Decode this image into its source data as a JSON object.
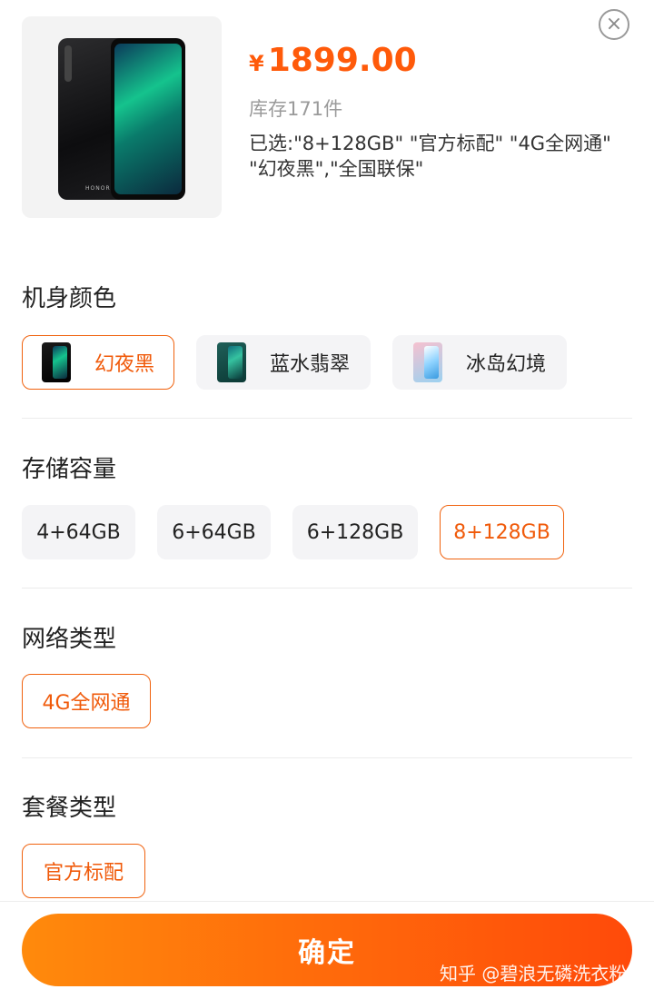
{
  "header": {
    "currency": "¥",
    "price": "1899.00",
    "stock": "库存171件",
    "selected_line1": "已选:\"8+128GB\" \"官方标配\" \"4G全网通\"",
    "selected_line2": "\"幻夜黑\",\"全国联保\"",
    "close_icon": "close-icon",
    "phone_brand": "HONOR"
  },
  "sections": {
    "color": {
      "title": "机身颜色",
      "options": [
        "幻夜黑",
        "蓝水翡翠",
        "冰岛幻境"
      ],
      "selected": "幻夜黑"
    },
    "storage": {
      "title": "存储容量",
      "options": [
        "4+64GB",
        "6+64GB",
        "6+128GB",
        "8+128GB"
      ],
      "selected": "8+128GB"
    },
    "network": {
      "title": "网络类型",
      "options": [
        "4G全网通"
      ],
      "selected": "4G全网通"
    },
    "package": {
      "title": "套餐类型",
      "options": [
        "官方标配"
      ],
      "selected": "官方标配"
    }
  },
  "footer": {
    "confirm_label": "确定",
    "watermark": "知乎 @碧浪无磷洗衣粉"
  },
  "colors": {
    "accent": "#ff5a0a",
    "option_bg": "#f4f4f6",
    "confirm_gradient": [
      "#ff8a0c",
      "#ff4a0a"
    ]
  }
}
